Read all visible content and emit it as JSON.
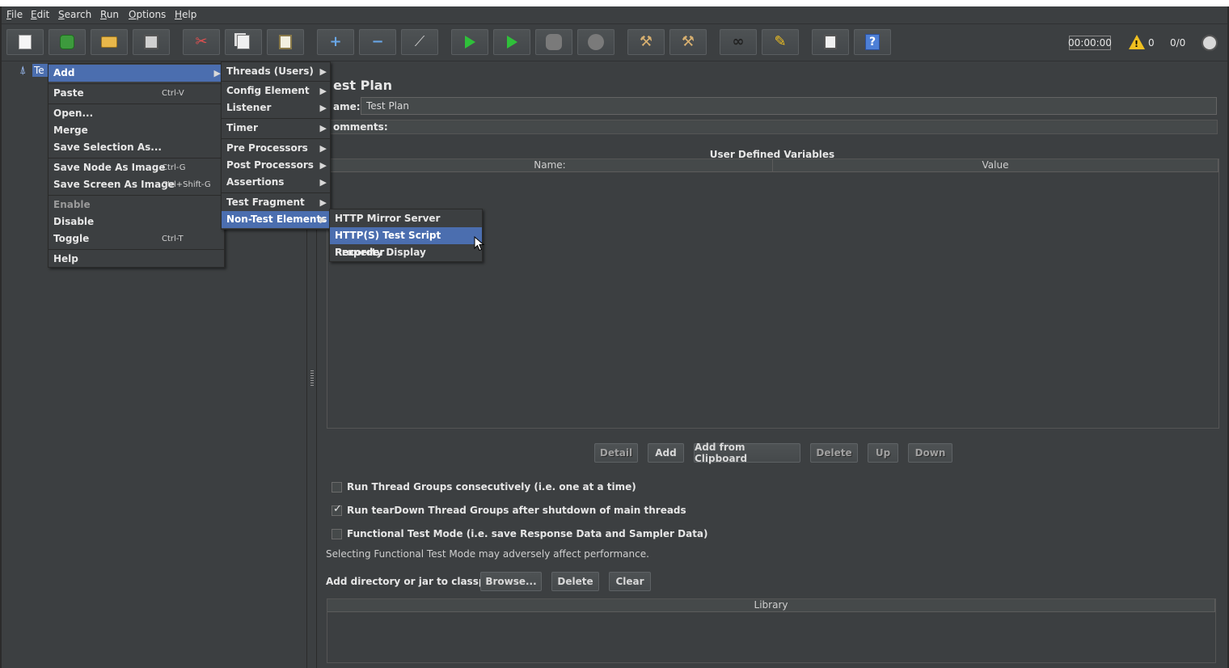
{
  "menubar": {
    "items": [
      {
        "key": "F",
        "rest": "ile"
      },
      {
        "key": "E",
        "rest": "dit"
      },
      {
        "key": "S",
        "rest": "earch"
      },
      {
        "key": "R",
        "rest": "un"
      },
      {
        "key": "O",
        "rest": "ptions"
      },
      {
        "key": "H",
        "rest": "elp"
      }
    ]
  },
  "toolbar": {
    "timer": "00:00:00",
    "warning_count": "0",
    "thread_count": "0/0"
  },
  "tree": {
    "root_label": "Te"
  },
  "context_menu": {
    "items": [
      {
        "label": "Add",
        "shortcut": "",
        "submenu": true,
        "selected": true,
        "disabled": false
      },
      {
        "label": "Paste",
        "shortcut": "Ctrl-V",
        "submenu": false,
        "selected": false,
        "disabled": false
      },
      {
        "label": "Open...",
        "shortcut": "",
        "submenu": false,
        "selected": false,
        "disabled": false
      },
      {
        "label": "Merge",
        "shortcut": "",
        "submenu": false,
        "selected": false,
        "disabled": false
      },
      {
        "label": "Save Selection As...",
        "shortcut": "",
        "submenu": false,
        "selected": false,
        "disabled": false
      },
      {
        "label": "Save Node As Image",
        "shortcut": "Ctrl-G",
        "submenu": false,
        "selected": false,
        "disabled": false
      },
      {
        "label": "Save Screen As Image",
        "shortcut": "Ctrl+Shift-G",
        "submenu": false,
        "selected": false,
        "disabled": false
      },
      {
        "label": "Enable",
        "shortcut": "",
        "submenu": false,
        "selected": false,
        "disabled": true
      },
      {
        "label": "Disable",
        "shortcut": "",
        "submenu": false,
        "selected": false,
        "disabled": false
      },
      {
        "label": "Toggle",
        "shortcut": "Ctrl-T",
        "submenu": false,
        "selected": false,
        "disabled": false
      },
      {
        "label": "Help",
        "shortcut": "",
        "submenu": false,
        "selected": false,
        "disabled": false
      }
    ]
  },
  "add_submenu": {
    "items": [
      {
        "label": "Threads (Users)",
        "selected": false
      },
      {
        "label": "Config Element",
        "selected": false
      },
      {
        "label": "Listener",
        "selected": false
      },
      {
        "label": "Timer",
        "selected": false
      },
      {
        "label": "Pre Processors",
        "selected": false
      },
      {
        "label": "Post Processors",
        "selected": false
      },
      {
        "label": "Assertions",
        "selected": false
      },
      {
        "label": "Test Fragment",
        "selected": false
      },
      {
        "label": "Non-Test Elements",
        "selected": true
      }
    ]
  },
  "nontest_submenu": {
    "items": [
      {
        "label": "HTTP Mirror Server",
        "selected": false
      },
      {
        "label": "HTTP(S) Test Script Recorder",
        "selected": true
      },
      {
        "label": "Property Display",
        "selected": false
      }
    ]
  },
  "test_plan": {
    "title": "est Plan",
    "name_label": "ame:",
    "name_value": "Test Plan",
    "comments_label": "omments:",
    "udv_title": "User Defined Variables",
    "columns": [
      "Name:",
      "Value"
    ],
    "buttons": {
      "detail": "Detail",
      "add": "Add",
      "add_from_clipboard": "Add from Clipboard",
      "delete": "Delete",
      "up": "Up",
      "down": "Down"
    },
    "options": [
      {
        "label": "Run Thread Groups consecutively (i.e. one at a time)",
        "checked": false
      },
      {
        "label": "Run tearDown Thread Groups after shutdown of main threads",
        "checked": true
      },
      {
        "label": "Functional Test Mode (i.e. save Response Data and Sampler Data)",
        "checked": false
      }
    ],
    "functional_note": "Selecting Functional Test Mode may adversely affect performance.",
    "classpath_label": "Add directory or jar to classpath",
    "classpath_buttons": {
      "browse": "Browse...",
      "delete": "Delete",
      "clear": "Clear"
    },
    "library_header": "Library"
  },
  "colors": {
    "background": "#3c3f41",
    "selection": "#4b6eaf",
    "run_green": "#2fc03a",
    "warning_yellow": "#f0c020"
  }
}
